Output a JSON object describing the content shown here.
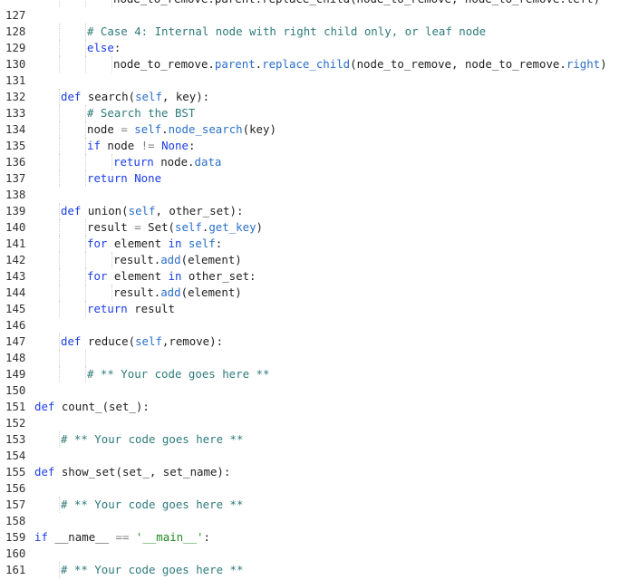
{
  "editor": {
    "language": "python",
    "lines": [
      {
        "n": "",
        "indent": 3,
        "tokens": [
          {
            "t": "node_to_remove.parent.replace_child(node_to_remove, node_to_remove.left)",
            "c": "fn"
          }
        ]
      },
      {
        "n": "127",
        "indent": 0,
        "tokens": []
      },
      {
        "n": "128",
        "indent": 2,
        "tokens": [
          {
            "t": "# Case 4: Internal node with right child only, or leaf node",
            "c": "cm"
          }
        ]
      },
      {
        "n": "129",
        "indent": 2,
        "tokens": [
          {
            "t": "else",
            "c": "kw"
          },
          {
            "t": ":",
            "c": "fn"
          }
        ]
      },
      {
        "n": "130",
        "indent": 3,
        "tokens": [
          {
            "t": "node_to_remove.",
            "c": "fn"
          },
          {
            "t": "parent",
            "c": "bi"
          },
          {
            "t": ".",
            "c": "fn"
          },
          {
            "t": "replace_child",
            "c": "bi"
          },
          {
            "t": "(node_to_remove, node_to_remove.",
            "c": "fn"
          },
          {
            "t": "right",
            "c": "bi"
          },
          {
            "t": ")",
            "c": "fn"
          }
        ]
      },
      {
        "n": "131",
        "indent": 0,
        "tokens": []
      },
      {
        "n": "132",
        "indent": 1,
        "tokens": [
          {
            "t": "def ",
            "c": "kw"
          },
          {
            "t": "search(",
            "c": "fn"
          },
          {
            "t": "self",
            "c": "sf"
          },
          {
            "t": ", key):",
            "c": "fn"
          }
        ]
      },
      {
        "n": "133",
        "indent": 2,
        "tokens": [
          {
            "t": "# Search the BST",
            "c": "cm"
          }
        ]
      },
      {
        "n": "134",
        "indent": 2,
        "tokens": [
          {
            "t": "node ",
            "c": "fn"
          },
          {
            "t": "=",
            "c": "op"
          },
          {
            "t": " ",
            "c": "fn"
          },
          {
            "t": "self",
            "c": "sf"
          },
          {
            "t": ".",
            "c": "fn"
          },
          {
            "t": "node_search",
            "c": "bi"
          },
          {
            "t": "(key)",
            "c": "fn"
          }
        ]
      },
      {
        "n": "135",
        "indent": 2,
        "tokens": [
          {
            "t": "if ",
            "c": "kw"
          },
          {
            "t": "node ",
            "c": "fn"
          },
          {
            "t": "!=",
            "c": "op"
          },
          {
            "t": " ",
            "c": "fn"
          },
          {
            "t": "None",
            "c": "kw"
          },
          {
            "t": ":",
            "c": "fn"
          }
        ]
      },
      {
        "n": "136",
        "indent": 3,
        "tokens": [
          {
            "t": "return ",
            "c": "kw"
          },
          {
            "t": "node.",
            "c": "fn"
          },
          {
            "t": "data",
            "c": "bi"
          }
        ]
      },
      {
        "n": "137",
        "indent": 2,
        "tokens": [
          {
            "t": "return ",
            "c": "kw"
          },
          {
            "t": "None",
            "c": "kw"
          }
        ]
      },
      {
        "n": "138",
        "indent": 0,
        "tokens": []
      },
      {
        "n": "139",
        "indent": 1,
        "tokens": [
          {
            "t": "def ",
            "c": "kw"
          },
          {
            "t": "union(",
            "c": "fn"
          },
          {
            "t": "self",
            "c": "sf"
          },
          {
            "t": ", other_set):",
            "c": "fn"
          }
        ]
      },
      {
        "n": "140",
        "indent": 2,
        "tokens": [
          {
            "t": "result ",
            "c": "fn"
          },
          {
            "t": "=",
            "c": "op"
          },
          {
            "t": " Set(",
            "c": "fn"
          },
          {
            "t": "self",
            "c": "sf"
          },
          {
            "t": ".",
            "c": "fn"
          },
          {
            "t": "get_key",
            "c": "bi"
          },
          {
            "t": ")",
            "c": "fn"
          }
        ]
      },
      {
        "n": "141",
        "indent": 2,
        "tokens": [
          {
            "t": "for ",
            "c": "kw"
          },
          {
            "t": "element ",
            "c": "fn"
          },
          {
            "t": "in ",
            "c": "kw"
          },
          {
            "t": "self",
            "c": "sf"
          },
          {
            "t": ":",
            "c": "fn"
          }
        ]
      },
      {
        "n": "142",
        "indent": 3,
        "tokens": [
          {
            "t": "result.",
            "c": "fn"
          },
          {
            "t": "add",
            "c": "bi"
          },
          {
            "t": "(element)",
            "c": "fn"
          }
        ]
      },
      {
        "n": "143",
        "indent": 2,
        "tokens": [
          {
            "t": "for ",
            "c": "kw"
          },
          {
            "t": "element ",
            "c": "fn"
          },
          {
            "t": "in ",
            "c": "kw"
          },
          {
            "t": "other_set:",
            "c": "fn"
          }
        ]
      },
      {
        "n": "144",
        "indent": 3,
        "tokens": [
          {
            "t": "result.",
            "c": "fn"
          },
          {
            "t": "add",
            "c": "bi"
          },
          {
            "t": "(element)",
            "c": "fn"
          }
        ]
      },
      {
        "n": "145",
        "indent": 2,
        "tokens": [
          {
            "t": "return ",
            "c": "kw"
          },
          {
            "t": "result",
            "c": "fn"
          }
        ]
      },
      {
        "n": "146",
        "indent": 0,
        "tokens": []
      },
      {
        "n": "147",
        "indent": 1,
        "tokens": [
          {
            "t": "def ",
            "c": "kw"
          },
          {
            "t": "reduce(",
            "c": "fn"
          },
          {
            "t": "self",
            "c": "sf"
          },
          {
            "t": ",remove):",
            "c": "fn"
          }
        ]
      },
      {
        "n": "148",
        "indent": 0,
        "guides": 2,
        "tokens": []
      },
      {
        "n": "149",
        "indent": 2,
        "tokens": [
          {
            "t": "# ** Your code goes here **",
            "c": "cm"
          }
        ]
      },
      {
        "n": "150",
        "indent": 0,
        "tokens": []
      },
      {
        "n": "151",
        "indent": 0,
        "tokens": [
          {
            "t": "def ",
            "c": "kw"
          },
          {
            "t": "count_(set_):",
            "c": "fn"
          }
        ]
      },
      {
        "n": "152",
        "indent": 0,
        "tokens": []
      },
      {
        "n": "153",
        "indent": 1,
        "tokens": [
          {
            "t": "# ** Your code goes here **",
            "c": "cm"
          }
        ]
      },
      {
        "n": "154",
        "indent": 0,
        "tokens": []
      },
      {
        "n": "155",
        "indent": 0,
        "tokens": [
          {
            "t": "def ",
            "c": "kw"
          },
          {
            "t": "show_set(set_, set_name):",
            "c": "fn"
          }
        ]
      },
      {
        "n": "156",
        "indent": 0,
        "tokens": []
      },
      {
        "n": "157",
        "indent": 1,
        "tokens": [
          {
            "t": "# ** Your code goes here **",
            "c": "cm"
          }
        ]
      },
      {
        "n": "158",
        "indent": 0,
        "tokens": []
      },
      {
        "n": "159",
        "indent": 0,
        "tokens": [
          {
            "t": "if ",
            "c": "kw"
          },
          {
            "t": "__name__ ",
            "c": "fn"
          },
          {
            "t": "==",
            "c": "op"
          },
          {
            "t": " ",
            "c": "fn"
          },
          {
            "t": "'__main__'",
            "c": "st"
          },
          {
            "t": ":",
            "c": "fn"
          }
        ]
      },
      {
        "n": "160",
        "indent": 0,
        "tokens": []
      },
      {
        "n": "161",
        "indent": 1,
        "tokens": [
          {
            "t": "# ** Your code goes here **",
            "c": "cm"
          }
        ]
      }
    ]
  }
}
